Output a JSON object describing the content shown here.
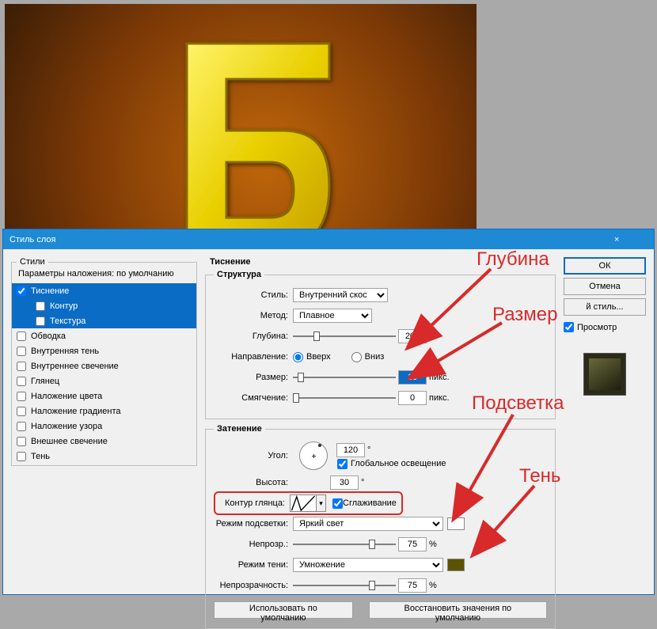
{
  "dialog": {
    "title": "Стиль слоя",
    "close": "×"
  },
  "styles_panel": {
    "legend": "Стили",
    "blend_default": "Параметры наложения: по умолчанию",
    "items": [
      {
        "label": "Тиснение",
        "checked": true,
        "selected": true,
        "sub": false
      },
      {
        "label": "Контур",
        "checked": false,
        "selected": true,
        "sub": true
      },
      {
        "label": "Текстура",
        "checked": false,
        "selected": true,
        "sub": true
      },
      {
        "label": "Обводка",
        "checked": false,
        "selected": false,
        "sub": false
      },
      {
        "label": "Внутренняя тень",
        "checked": false,
        "selected": false,
        "sub": false
      },
      {
        "label": "Внутреннее свечение",
        "checked": false,
        "selected": false,
        "sub": false
      },
      {
        "label": "Глянец",
        "checked": false,
        "selected": false,
        "sub": false
      },
      {
        "label": "Наложение цвета",
        "checked": false,
        "selected": false,
        "sub": false
      },
      {
        "label": "Наложение градиента",
        "checked": false,
        "selected": false,
        "sub": false
      },
      {
        "label": "Наложение узора",
        "checked": false,
        "selected": false,
        "sub": false
      },
      {
        "label": "Внешнее свечение",
        "checked": false,
        "selected": false,
        "sub": false
      },
      {
        "label": "Тень",
        "checked": false,
        "selected": false,
        "sub": false
      }
    ]
  },
  "main": {
    "title": "Тиснение",
    "structure": {
      "legend": "Структура",
      "style_label": "Стиль:",
      "style_value": "Внутренний скос",
      "method_label": "Метод:",
      "method_value": "Плавное",
      "depth_label": "Глубина:",
      "depth_value": "200",
      "depth_unit": "%",
      "direction_label": "Направление:",
      "dir_up": "Вверх",
      "dir_down": "Вниз",
      "size_label": "Размер:",
      "size_value": "10",
      "size_unit": "пикс.",
      "soften_label": "Смягчение:",
      "soften_value": "0",
      "soften_unit": "пикс."
    },
    "shading": {
      "legend": "Затенение",
      "angle_label": "Угол:",
      "angle_value": "120",
      "degree": "°",
      "global_label": "Глобальное освещение",
      "alt_label": "Высота:",
      "alt_value": "30",
      "gloss_label": "Контур глянца:",
      "antialias_label": "Сглаживание",
      "hmode_label": "Режим подсветки:",
      "hmode_value": "Яркий свет",
      "hopacity_label": "Непрозр.:",
      "hopacity_value": "75",
      "hopacity_unit": "%",
      "smode_label": "Режим тени:",
      "smode_value": "Умножение",
      "sopacity_label": "Непрозрачность:",
      "sopacity_value": "75",
      "sopacity_unit": "%",
      "highlight_color": "#ffffff",
      "shadow_color": "#5c5200"
    },
    "buttons": {
      "default": "Использовать по умолчанию",
      "reset": "Восстановить значения по умолчанию"
    }
  },
  "right": {
    "ok": "ОК",
    "cancel": "Отмена",
    "newstyle": "й стиль...",
    "preview": "Просмотр"
  },
  "annotations": {
    "depth": "Глубина",
    "size": "Размер",
    "highlight": "Подсветка",
    "shadow": "Тень"
  }
}
